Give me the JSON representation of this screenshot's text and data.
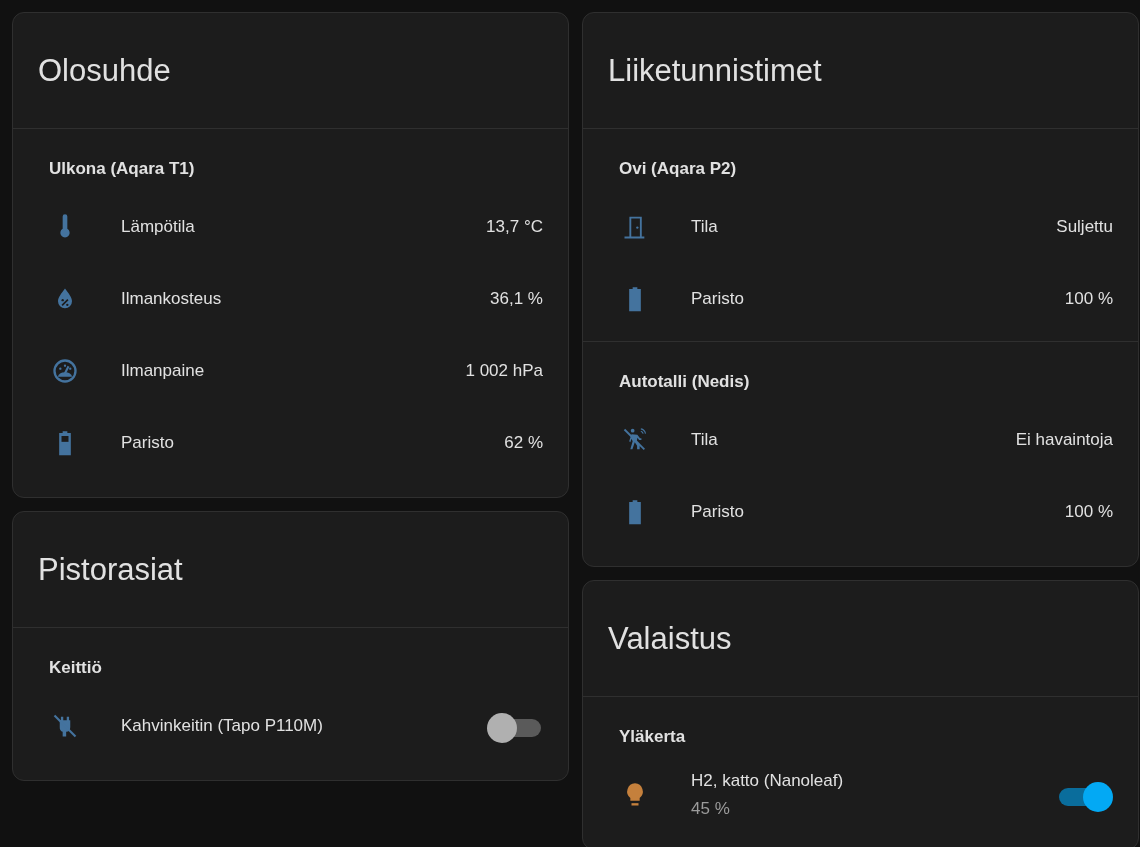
{
  "columns": [
    {
      "cards": [
        {
          "title": "Olosuhde",
          "sections": [
            {
              "title": "Ulkona (Aqara T1)",
              "rows": [
                {
                  "kind": "temperature",
                  "label": "Lämpötila",
                  "value": "13,7 °C"
                },
                {
                  "kind": "humidity",
                  "label": "Ilmankosteus",
                  "value": "36,1 %"
                },
                {
                  "kind": "pressure",
                  "label": "Ilmanpaine",
                  "value": "1 002 hPa"
                },
                {
                  "kind": "battery",
                  "label": "Paristo",
                  "value": "62 %"
                }
              ]
            }
          ]
        },
        {
          "title": "Pistorasiat",
          "sections": [
            {
              "title": "Keittiö",
              "rows": [
                {
                  "kind": "switch",
                  "label": "Kahvinkeitin (Tapo P110M)",
                  "on": false
                }
              ]
            }
          ]
        }
      ]
    },
    {
      "cards": [
        {
          "title": "Liiketunnistimet",
          "sections": [
            {
              "title": "Ovi (Aqara P2)",
              "rows": [
                {
                  "kind": "door",
                  "label": "Tila",
                  "value": "Suljettu"
                },
                {
                  "kind": "battery",
                  "label": "Paristo",
                  "value": "100 %"
                }
              ]
            },
            {
              "title": "Autotalli (Nedis)",
              "rows": [
                {
                  "kind": "motion",
                  "label": "Tila",
                  "value": "Ei havaintoja"
                },
                {
                  "kind": "battery",
                  "label": "Paristo",
                  "value": "100 %"
                }
              ]
            }
          ]
        },
        {
          "title": "Valaistus",
          "sections": [
            {
              "title": "Yläkerta",
              "rows": [
                {
                  "kind": "light",
                  "label": "H2, katto (Nanoleaf)",
                  "secondary": "45 %",
                  "on": true
                }
              ]
            }
          ]
        }
      ]
    }
  ]
}
